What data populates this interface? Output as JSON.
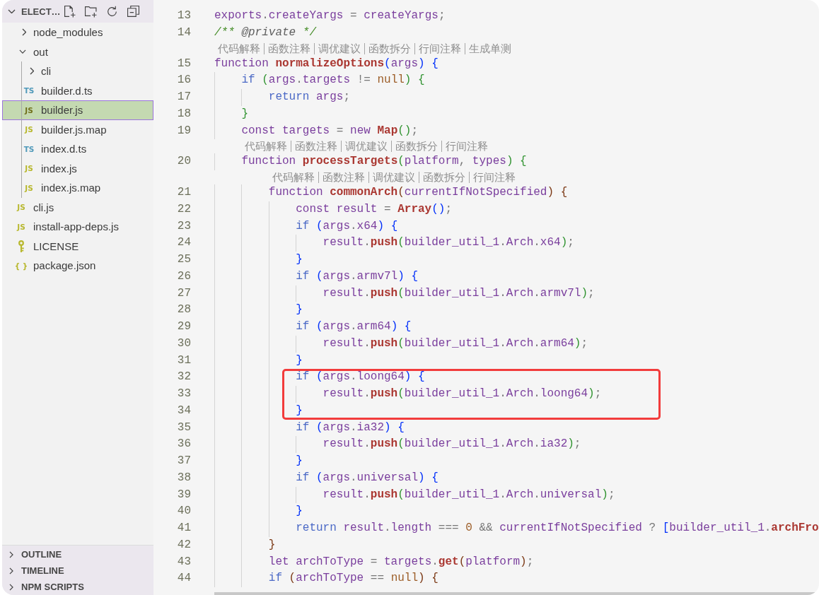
{
  "explorer": {
    "title": "ELECT…",
    "expanded": true,
    "actions": [
      {
        "kind": "new-file"
      },
      {
        "kind": "new-folder"
      },
      {
        "kind": "refresh"
      },
      {
        "kind": "collapse-all"
      }
    ],
    "tree": [
      {
        "label": "node_modules",
        "kind": "folder",
        "expanded": false,
        "selected": false
      },
      {
        "label": "out",
        "kind": "folder",
        "expanded": true,
        "selected": false,
        "children": [
          {
            "label": "cli",
            "kind": "folder",
            "expanded": false,
            "selected": false
          },
          {
            "label": "builder.d.ts",
            "kind": "ts",
            "icon": "TS",
            "selected": false
          },
          {
            "label": "builder.js",
            "kind": "js",
            "icon": "JS",
            "selected": true
          },
          {
            "label": "builder.js.map",
            "kind": "js",
            "icon": "JS",
            "selected": false
          },
          {
            "label": "index.d.ts",
            "kind": "ts",
            "icon": "TS",
            "selected": false
          },
          {
            "label": "index.js",
            "kind": "js",
            "icon": "JS",
            "selected": false
          },
          {
            "label": "index.js.map",
            "kind": "js",
            "icon": "JS",
            "selected": false
          }
        ]
      },
      {
        "label": "cli.js",
        "kind": "js",
        "icon": "JS",
        "selected": false
      },
      {
        "label": "install-app-deps.js",
        "kind": "js",
        "icon": "JS",
        "selected": false
      },
      {
        "label": "LICENSE",
        "kind": "license",
        "selected": false
      },
      {
        "label": "package.json",
        "kind": "json",
        "icon": "{ }",
        "selected": false
      }
    ]
  },
  "panels": [
    {
      "title": "OUTLINE",
      "expanded": false
    },
    {
      "title": "TIMELINE",
      "expanded": false
    },
    {
      "title": "NPM SCRIPTS",
      "expanded": false
    }
  ],
  "editor": {
    "lines": [
      {
        "number": "13",
        "tokens": [
          {
            "kind": "id",
            "text": "exports"
          },
          {
            "kind": "op",
            "text": "."
          },
          {
            "kind": "id",
            "text": "createYargs"
          },
          {
            "kind": "op",
            "text": " = "
          },
          {
            "kind": "id",
            "text": "createYargs"
          },
          {
            "kind": "op",
            "text": ";"
          }
        ]
      },
      {
        "number": "14",
        "tokens": [
          {
            "kind": "cm",
            "text": "/** "
          },
          {
            "kind": "tag",
            "text": "@private"
          },
          {
            "kind": "cm",
            "text": " */"
          }
        ]
      },
      {
        "number": "15",
        "codelens": [
          "代码解释",
          "函数注释",
          "调优建议",
          "函数拆分",
          "行间注释",
          "生成单测"
        ],
        "tokens": [
          {
            "kind": "id",
            "text": "function "
          },
          {
            "kind": "fn",
            "text": "normalizeOptions"
          },
          {
            "kind": "b1",
            "text": "("
          },
          {
            "kind": "id",
            "text": "args"
          },
          {
            "kind": "b1",
            "text": ")"
          },
          {
            "kind": "b1",
            "text": " {"
          }
        ],
        "children": [
          {
            "number": "16",
            "tokens": [
              {
                "kind": "kw",
                "text": "if "
              },
              {
                "kind": "b2",
                "text": "("
              },
              {
                "kind": "id",
                "text": "args"
              },
              {
                "kind": "op",
                "text": "."
              },
              {
                "kind": "id",
                "text": "targets"
              },
              {
                "kind": "op",
                "text": " != "
              },
              {
                "kind": "num",
                "text": "null"
              },
              {
                "kind": "b2",
                "text": ")"
              },
              {
                "kind": "b2",
                "text": " {"
              }
            ],
            "children": [
              {
                "number": "17",
                "tokens": [
                  {
                    "kind": "kw",
                    "text": "return "
                  },
                  {
                    "kind": "id",
                    "text": "args"
                  },
                  {
                    "kind": "op",
                    "text": ";"
                  }
                ]
              }
            ],
            "close": {
              "number": "18",
              "tokens": [
                {
                  "kind": "b2",
                  "text": "}"
                }
              ]
            }
          },
          {
            "number": "19",
            "tokens": [
              {
                "kind": "id",
                "text": "const targets"
              },
              {
                "kind": "op",
                "text": " = "
              },
              {
                "kind": "id",
                "text": "new "
              },
              {
                "kind": "fn",
                "text": "Map"
              },
              {
                "kind": "b2",
                "text": "()"
              },
              {
                "kind": "op",
                "text": ";"
              }
            ]
          },
          {
            "number": "20",
            "codelens": [
              "代码解释",
              "函数注释",
              "调优建议",
              "函数拆分",
              "行间注释"
            ],
            "tokens": [
              {
                "kind": "id",
                "text": "function "
              },
              {
                "kind": "fn",
                "text": "processTargets"
              },
              {
                "kind": "b2",
                "text": "("
              },
              {
                "kind": "id",
                "text": "platform"
              },
              {
                "kind": "op",
                "text": ", "
              },
              {
                "kind": "id",
                "text": "types"
              },
              {
                "kind": "b2",
                "text": ")"
              },
              {
                "kind": "b2",
                "text": " {"
              }
            ],
            "children": [
              {
                "number": "21",
                "codelens": [
                  "代码解释",
                  "函数注释",
                  "调优建议",
                  "函数拆分",
                  "行间注释"
                ],
                "tokens": [
                  {
                    "kind": "id",
                    "text": "function "
                  },
                  {
                    "kind": "fn",
                    "text": "commonArch"
                  },
                  {
                    "kind": "b3",
                    "text": "("
                  },
                  {
                    "kind": "id",
                    "text": "currentIfNotSpecified"
                  },
                  {
                    "kind": "b3",
                    "text": ")"
                  },
                  {
                    "kind": "b3",
                    "text": " {"
                  }
                ],
                "children": [
                  {
                    "number": "22",
                    "tokens": [
                      {
                        "kind": "id",
                        "text": "const result"
                      },
                      {
                        "kind": "op",
                        "text": " = "
                      },
                      {
                        "kind": "fn",
                        "text": "Array"
                      },
                      {
                        "kind": "b1",
                        "text": "()"
                      },
                      {
                        "kind": "op",
                        "text": ";"
                      }
                    ]
                  },
                  {
                    "number": "23",
                    "tokens": [
                      {
                        "kind": "kw",
                        "text": "if "
                      },
                      {
                        "kind": "b1",
                        "text": "("
                      },
                      {
                        "kind": "id",
                        "text": "args"
                      },
                      {
                        "kind": "op",
                        "text": "."
                      },
                      {
                        "kind": "id",
                        "text": "x64"
                      },
                      {
                        "kind": "b1",
                        "text": ")"
                      },
                      {
                        "kind": "b1",
                        "text": " {"
                      }
                    ],
                    "children": [
                      {
                        "number": "24",
                        "tokens": [
                          {
                            "kind": "id",
                            "text": "result"
                          },
                          {
                            "kind": "op",
                            "text": "."
                          },
                          {
                            "kind": "fn",
                            "text": "push"
                          },
                          {
                            "kind": "b2",
                            "text": "("
                          },
                          {
                            "kind": "id",
                            "text": "builder_util_1"
                          },
                          {
                            "kind": "op",
                            "text": "."
                          },
                          {
                            "kind": "id",
                            "text": "Arch"
                          },
                          {
                            "kind": "op",
                            "text": "."
                          },
                          {
                            "kind": "id",
                            "text": "x64"
                          },
                          {
                            "kind": "b2",
                            "text": ")"
                          },
                          {
                            "kind": "op",
                            "text": ";"
                          }
                        ]
                      }
                    ],
                    "close": {
                      "number": "25",
                      "tokens": [
                        {
                          "kind": "b1",
                          "text": "}"
                        }
                      ]
                    }
                  },
                  {
                    "number": "26",
                    "tokens": [
                      {
                        "kind": "kw",
                        "text": "if "
                      },
                      {
                        "kind": "b1",
                        "text": "("
                      },
                      {
                        "kind": "id",
                        "text": "args"
                      },
                      {
                        "kind": "op",
                        "text": "."
                      },
                      {
                        "kind": "id",
                        "text": "armv7l"
                      },
                      {
                        "kind": "b1",
                        "text": ")"
                      },
                      {
                        "kind": "b1",
                        "text": " {"
                      }
                    ],
                    "children": [
                      {
                        "number": "27",
                        "tokens": [
                          {
                            "kind": "id",
                            "text": "result"
                          },
                          {
                            "kind": "op",
                            "text": "."
                          },
                          {
                            "kind": "fn",
                            "text": "push"
                          },
                          {
                            "kind": "b2",
                            "text": "("
                          },
                          {
                            "kind": "id",
                            "text": "builder_util_1"
                          },
                          {
                            "kind": "op",
                            "text": "."
                          },
                          {
                            "kind": "id",
                            "text": "Arch"
                          },
                          {
                            "kind": "op",
                            "text": "."
                          },
                          {
                            "kind": "id",
                            "text": "armv7l"
                          },
                          {
                            "kind": "b2",
                            "text": ")"
                          },
                          {
                            "kind": "op",
                            "text": ";"
                          }
                        ]
                      }
                    ],
                    "close": {
                      "number": "28",
                      "tokens": [
                        {
                          "kind": "b1",
                          "text": "}"
                        }
                      ]
                    }
                  },
                  {
                    "number": "29",
                    "tokens": [
                      {
                        "kind": "kw",
                        "text": "if "
                      },
                      {
                        "kind": "b1",
                        "text": "("
                      },
                      {
                        "kind": "id",
                        "text": "args"
                      },
                      {
                        "kind": "op",
                        "text": "."
                      },
                      {
                        "kind": "id",
                        "text": "arm64"
                      },
                      {
                        "kind": "b1",
                        "text": ")"
                      },
                      {
                        "kind": "b1",
                        "text": " {"
                      }
                    ],
                    "children": [
                      {
                        "number": "30",
                        "tokens": [
                          {
                            "kind": "id",
                            "text": "result"
                          },
                          {
                            "kind": "op",
                            "text": "."
                          },
                          {
                            "kind": "fn",
                            "text": "push"
                          },
                          {
                            "kind": "b2",
                            "text": "("
                          },
                          {
                            "kind": "id",
                            "text": "builder_util_1"
                          },
                          {
                            "kind": "op",
                            "text": "."
                          },
                          {
                            "kind": "id",
                            "text": "Arch"
                          },
                          {
                            "kind": "op",
                            "text": "."
                          },
                          {
                            "kind": "id",
                            "text": "arm64"
                          },
                          {
                            "kind": "b2",
                            "text": ")"
                          },
                          {
                            "kind": "op",
                            "text": ";"
                          }
                        ]
                      }
                    ],
                    "close": {
                      "number": "31",
                      "tokens": [
                        {
                          "kind": "b1",
                          "text": "}"
                        }
                      ]
                    }
                  },
                  {
                    "number": "32",
                    "highlighted": true,
                    "tokens": [
                      {
                        "kind": "kw",
                        "text": "if "
                      },
                      {
                        "kind": "b1",
                        "text": "("
                      },
                      {
                        "kind": "id",
                        "text": "args"
                      },
                      {
                        "kind": "op",
                        "text": "."
                      },
                      {
                        "kind": "id",
                        "text": "loong64"
                      },
                      {
                        "kind": "b1",
                        "text": ")"
                      },
                      {
                        "kind": "b1",
                        "text": " {"
                      }
                    ],
                    "children": [
                      {
                        "number": "33",
                        "tokens": [
                          {
                            "kind": "id",
                            "text": "result"
                          },
                          {
                            "kind": "op",
                            "text": "."
                          },
                          {
                            "kind": "fn",
                            "text": "push"
                          },
                          {
                            "kind": "b2",
                            "text": "("
                          },
                          {
                            "kind": "id",
                            "text": "builder_util_1"
                          },
                          {
                            "kind": "op",
                            "text": "."
                          },
                          {
                            "kind": "id",
                            "text": "Arch"
                          },
                          {
                            "kind": "op",
                            "text": "."
                          },
                          {
                            "kind": "id",
                            "text": "loong64"
                          },
                          {
                            "kind": "b2",
                            "text": ")"
                          },
                          {
                            "kind": "op",
                            "text": ";"
                          }
                        ]
                      }
                    ],
                    "close": {
                      "number": "34",
                      "tokens": [
                        {
                          "kind": "b1",
                          "text": "}"
                        }
                      ]
                    }
                  },
                  {
                    "number": "35",
                    "tokens": [
                      {
                        "kind": "kw",
                        "text": "if "
                      },
                      {
                        "kind": "b1",
                        "text": "("
                      },
                      {
                        "kind": "id",
                        "text": "args"
                      },
                      {
                        "kind": "op",
                        "text": "."
                      },
                      {
                        "kind": "id",
                        "text": "ia32"
                      },
                      {
                        "kind": "b1",
                        "text": ")"
                      },
                      {
                        "kind": "b1",
                        "text": " {"
                      }
                    ],
                    "children": [
                      {
                        "number": "36",
                        "tokens": [
                          {
                            "kind": "id",
                            "text": "result"
                          },
                          {
                            "kind": "op",
                            "text": "."
                          },
                          {
                            "kind": "fn",
                            "text": "push"
                          },
                          {
                            "kind": "b2",
                            "text": "("
                          },
                          {
                            "kind": "id",
                            "text": "builder_util_1"
                          },
                          {
                            "kind": "op",
                            "text": "."
                          },
                          {
                            "kind": "id",
                            "text": "Arch"
                          },
                          {
                            "kind": "op",
                            "text": "."
                          },
                          {
                            "kind": "id",
                            "text": "ia32"
                          },
                          {
                            "kind": "b2",
                            "text": ")"
                          },
                          {
                            "kind": "op",
                            "text": ";"
                          }
                        ]
                      }
                    ],
                    "close": {
                      "number": "37",
                      "tokens": [
                        {
                          "kind": "b1",
                          "text": "}"
                        }
                      ]
                    }
                  },
                  {
                    "number": "38",
                    "tokens": [
                      {
                        "kind": "kw",
                        "text": "if "
                      },
                      {
                        "kind": "b1",
                        "text": "("
                      },
                      {
                        "kind": "id",
                        "text": "args"
                      },
                      {
                        "kind": "op",
                        "text": "."
                      },
                      {
                        "kind": "id",
                        "text": "universal"
                      },
                      {
                        "kind": "b1",
                        "text": ")"
                      },
                      {
                        "kind": "b1",
                        "text": " {"
                      }
                    ],
                    "children": [
                      {
                        "number": "39",
                        "tokens": [
                          {
                            "kind": "id",
                            "text": "result"
                          },
                          {
                            "kind": "op",
                            "text": "."
                          },
                          {
                            "kind": "fn",
                            "text": "push"
                          },
                          {
                            "kind": "b2",
                            "text": "("
                          },
                          {
                            "kind": "id",
                            "text": "builder_util_1"
                          },
                          {
                            "kind": "op",
                            "text": "."
                          },
                          {
                            "kind": "id",
                            "text": "Arch"
                          },
                          {
                            "kind": "op",
                            "text": "."
                          },
                          {
                            "kind": "id",
                            "text": "universal"
                          },
                          {
                            "kind": "b2",
                            "text": ")"
                          },
                          {
                            "kind": "op",
                            "text": ";"
                          }
                        ]
                      }
                    ],
                    "close": {
                      "number": "40",
                      "tokens": [
                        {
                          "kind": "b1",
                          "text": "}"
                        }
                      ]
                    }
                  },
                  {
                    "number": "41",
                    "tokens": [
                      {
                        "kind": "kw",
                        "text": "return "
                      },
                      {
                        "kind": "id",
                        "text": "result"
                      },
                      {
                        "kind": "op",
                        "text": "."
                      },
                      {
                        "kind": "id",
                        "text": "length"
                      },
                      {
                        "kind": "op",
                        "text": " === "
                      },
                      {
                        "kind": "num",
                        "text": "0"
                      },
                      {
                        "kind": "op",
                        "text": " && "
                      },
                      {
                        "kind": "id",
                        "text": "currentIfNotSpecified"
                      },
                      {
                        "kind": "op",
                        "text": " ? "
                      },
                      {
                        "kind": "b1",
                        "text": "["
                      },
                      {
                        "kind": "id",
                        "text": "builder_util_1"
                      },
                      {
                        "kind": "op",
                        "text": "."
                      },
                      {
                        "kind": "fn",
                        "text": "archFro"
                      }
                    ]
                  }
                ],
                "close": {
                  "number": "42",
                  "tokens": [
                    {
                      "kind": "b3",
                      "text": "}"
                    }
                  ]
                }
              },
              {
                "number": "43",
                "tokens": [
                  {
                    "kind": "id",
                    "text": "let archToType"
                  },
                  {
                    "kind": "op",
                    "text": " = "
                  },
                  {
                    "kind": "id",
                    "text": "targets"
                  },
                  {
                    "kind": "op",
                    "text": "."
                  },
                  {
                    "kind": "fn",
                    "text": "get"
                  },
                  {
                    "kind": "b3",
                    "text": "("
                  },
                  {
                    "kind": "id",
                    "text": "platform"
                  },
                  {
                    "kind": "b3",
                    "text": ")"
                  },
                  {
                    "kind": "op",
                    "text": ";"
                  }
                ]
              },
              {
                "number": "44",
                "tokens": [
                  {
                    "kind": "kw",
                    "text": "if "
                  },
                  {
                    "kind": "b3",
                    "text": "("
                  },
                  {
                    "kind": "id",
                    "text": "archToType"
                  },
                  {
                    "kind": "op",
                    "text": " == "
                  },
                  {
                    "kind": "num",
                    "text": "null"
                  },
                  {
                    "kind": "b3",
                    "text": ")"
                  },
                  {
                    "kind": "b3",
                    "text": " {"
                  }
                ]
              }
            ]
          }
        ]
      }
    ]
  }
}
